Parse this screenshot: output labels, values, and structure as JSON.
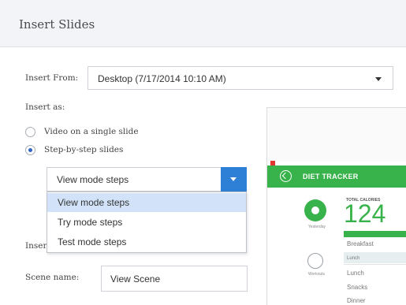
{
  "header": {
    "title": "Insert Slides"
  },
  "insert_from": {
    "label": "Insert From:",
    "value": "Desktop (7/17/2014 10:10 AM)"
  },
  "insert_as": {
    "label": "Insert as:",
    "options": [
      {
        "label": "Video on a single slide",
        "selected": false
      },
      {
        "label": "Step-by-step slides",
        "selected": true
      }
    ]
  },
  "mode": {
    "value": "View mode steps",
    "options": [
      "View mode steps",
      "Try mode steps",
      "Test mode steps"
    ],
    "highlighted_index": 0
  },
  "insert_partial_label": "Inser",
  "scene_name": {
    "label": "Scene name:",
    "value": "View Scene"
  },
  "preview": {
    "app_title": "DIET TRACKER",
    "total_calories_label": "TOTAL CALORIES",
    "calories": "124",
    "left_caption_1": "Yesterday",
    "left_caption_2": "Workouts",
    "rows": [
      "Breakfast",
      "Lunch",
      "Snacks",
      "Dinner"
    ],
    "row_bullet": "Lunch"
  },
  "colors": {
    "accent": "#2e7fd6",
    "app_green": "#38b24a",
    "highlight": "#d2e3f9"
  }
}
